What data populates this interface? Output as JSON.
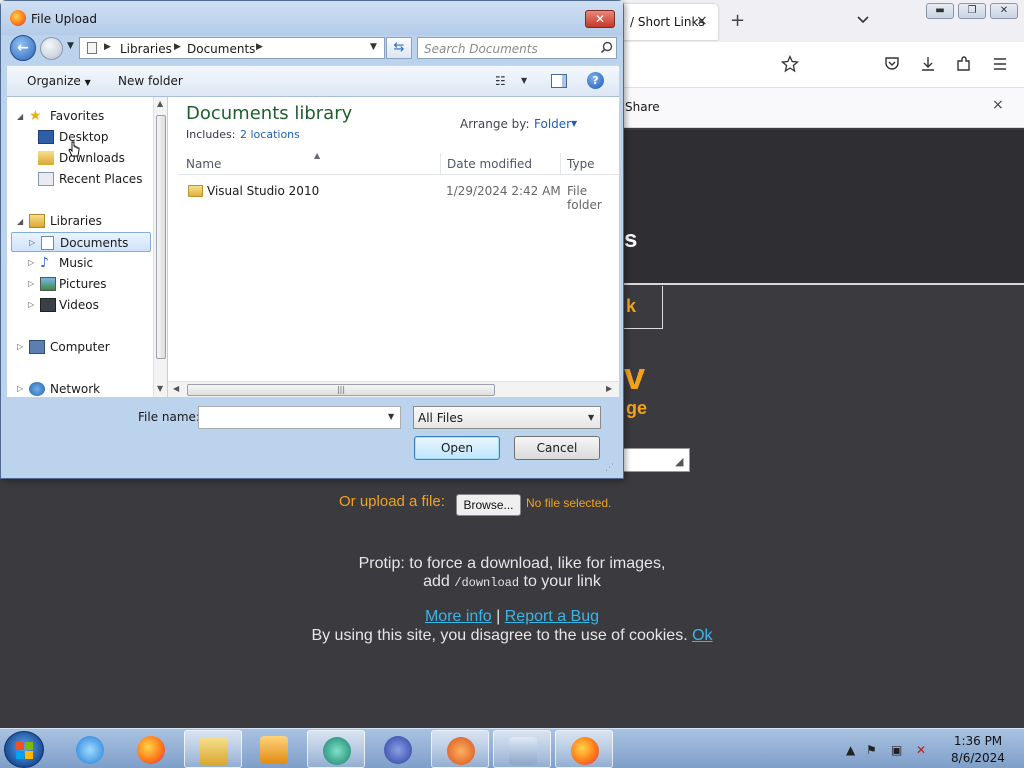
{
  "browser": {
    "tab_title": "/ Short Links",
    "tab_close": "×",
    "new_tab": "+",
    "share_label": "Share",
    "share_close": "×",
    "header_fragment": "s",
    "link_fragment": "k",
    "big_fragment": "v",
    "big_sub_fragment": "ge",
    "upload_label": "Or upload a file:",
    "browse_button": "Browse...",
    "no_file": "No file selected.",
    "protip_line1": "Protip: to force a download, like for images,",
    "protip_add": "add",
    "protip_code": "/download",
    "protip_tail": "to your link",
    "more_info": "More info",
    "separator": "|",
    "report_bug": "Report a Bug",
    "cookie_text": "By using this site, you disagree to the use of cookies.",
    "cookie_ok": "Ok"
  },
  "dialog": {
    "title": "File Upload",
    "close_glyph": "✕",
    "address": {
      "crumbs": [
        "Libraries",
        "Documents"
      ],
      "search_placeholder": "Search Documents"
    },
    "toolbar": {
      "organize": "Organize",
      "new_folder": "New folder"
    },
    "nav": {
      "favorites": "Favorites",
      "desktop": "Desktop",
      "downloads": "Downloads",
      "recent_places": "Recent Places",
      "libraries": "Libraries",
      "documents": "Documents",
      "music": "Music",
      "pictures": "Pictures",
      "videos": "Videos",
      "computer": "Computer",
      "network": "Network"
    },
    "library": {
      "title": "Documents library",
      "includes_label": "Includes:",
      "locations": "2 locations",
      "arrange_label": "Arrange by:",
      "arrange_value": "Folder"
    },
    "columns": [
      "Name",
      "Date modified",
      "Type"
    ],
    "files": [
      {
        "name": "Visual Studio 2010",
        "date": "1/29/2024 2:42 AM",
        "type": "File folder"
      }
    ],
    "file_name_label": "File name:",
    "file_name_value": "",
    "file_type": "All Files",
    "open_button": "Open",
    "cancel_button": "Cancel"
  },
  "taskbar": {
    "time": "1:36 PM",
    "date": "8/6/2024"
  },
  "colors": {
    "page_bg": "#3b3b3f",
    "accent_orange": "#f4a21a",
    "link_blue": "#38b6e8",
    "library_title_green": "#1e5f2d"
  }
}
